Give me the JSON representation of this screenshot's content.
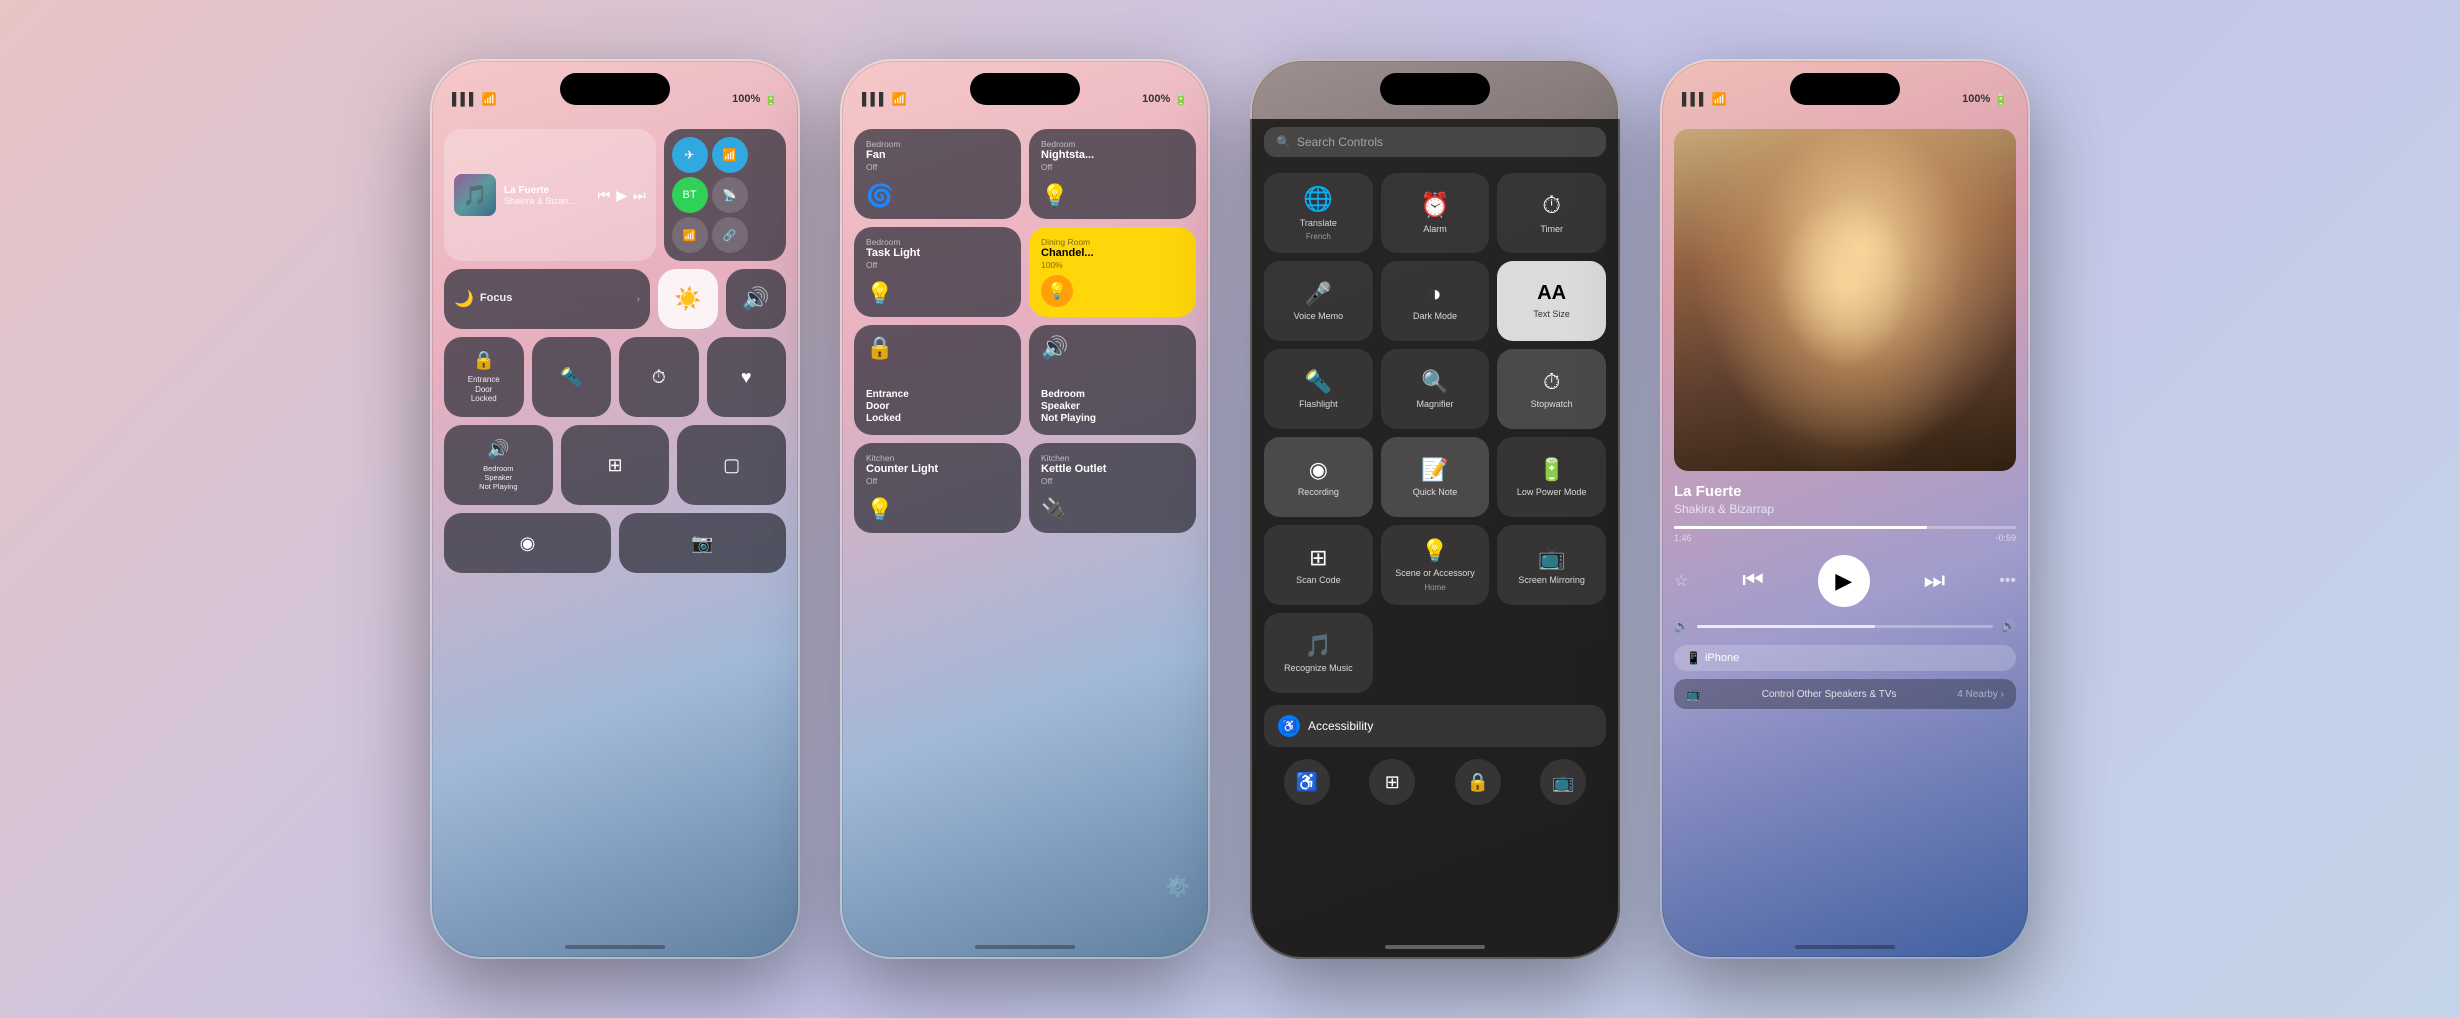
{
  "phones": [
    {
      "id": "phone1",
      "type": "control-center",
      "status": {
        "signal": "▌▌▌",
        "wifi": "WiFi",
        "battery": "100%"
      },
      "music": {
        "title": "La Fuerte",
        "artist": "Shakira & Bizarr..."
      },
      "connectivity": {
        "airplane": "✈",
        "wifi": "WiFi",
        "bluetooth": "BT",
        "cellular": "Cell",
        "airdrop": "AirDrop",
        "hotspot": "Hotspot"
      },
      "tiles": [
        {
          "icon": "🔒",
          "label": "Entrance\nDoor\nLocked",
          "type": "dark"
        },
        {
          "icon": "🔦",
          "label": "Flashlight",
          "type": "dark"
        },
        {
          "icon": "⏱",
          "label": "Timer",
          "type": "dark"
        },
        {
          "icon": "🔊",
          "label": "Bedroom\nSpeaker\nNot Playing",
          "type": "dark"
        },
        {
          "icon": "⊞",
          "label": "Calculator",
          "type": "dark"
        },
        {
          "icon": "▢",
          "label": "Screen Mirroring",
          "type": "dark"
        },
        {
          "icon": "◉",
          "label": "Recording",
          "type": "dark"
        },
        {
          "icon": "📷",
          "label": "Camera",
          "type": "dark"
        }
      ],
      "focus": "Focus",
      "brightness": "Brightness",
      "volume": "Volume"
    },
    {
      "id": "phone2",
      "type": "smart-home",
      "status": {
        "signal": "▌▌▌",
        "wifi": "WiFi",
        "battery": "100%"
      },
      "home_tiles": [
        {
          "room": "Bedroom",
          "name": "Fan",
          "status": "Off",
          "icon": "🌀"
        },
        {
          "room": "Bedroom",
          "name": "Nightsta...",
          "status": "Off",
          "icon": "💡"
        },
        {
          "room": "Bedroom",
          "name": "Task Light",
          "status": "Off",
          "icon": "💡"
        },
        {
          "room": "Dining Room",
          "name": "Chandel...",
          "status": "100%",
          "icon": "💡",
          "active": true
        },
        {
          "room": "",
          "name": "Entrance\nDoor\nLocked",
          "status": "",
          "icon": "🔒"
        },
        {
          "room": "",
          "name": "Bedroom\nSpeaker\nNot Playing",
          "status": "",
          "icon": "🔊"
        },
        {
          "room": "Kitchen",
          "name": "Counter Light",
          "status": "Off",
          "icon": "💡"
        },
        {
          "room": "Kitchen",
          "name": "Kettle Outlet",
          "status": "Off",
          "icon": "🔌"
        }
      ]
    },
    {
      "id": "phone3",
      "type": "add-controls",
      "search_placeholder": "Search Controls",
      "controls": [
        {
          "icon": "🌐",
          "name": "Translate",
          "sub": "French"
        },
        {
          "icon": "⏰",
          "name": "Alarm",
          "sub": ""
        },
        {
          "icon": "⏱",
          "name": "Timer",
          "sub": ""
        },
        {
          "icon": "🎤",
          "name": "Voice Memo",
          "sub": ""
        },
        {
          "icon": "◑",
          "name": "Dark Mode",
          "sub": ""
        },
        {
          "icon": "AA",
          "name": "Text Size",
          "sub": "",
          "special": "text-size"
        },
        {
          "icon": "🔦",
          "name": "Flashlight",
          "sub": ""
        },
        {
          "icon": "🔍",
          "name": "Magnifier",
          "sub": ""
        },
        {
          "icon": "⏱",
          "name": "Stopwatch",
          "sub": ""
        },
        {
          "icon": "◉",
          "name": "Recording",
          "sub": ""
        },
        {
          "icon": "📝",
          "name": "Quick Note",
          "sub": ""
        },
        {
          "icon": "🔋",
          "name": "Low Power\nMode",
          "sub": ""
        },
        {
          "icon": "⊞",
          "name": "Scan Code",
          "sub": ""
        },
        {
          "icon": "💡",
          "name": "Scene or\nAccessory",
          "sub": "Home"
        },
        {
          "icon": "📺",
          "name": "Screen\nMirroring",
          "sub": ""
        },
        {
          "icon": "🎵",
          "name": "Recognize\nMusic",
          "sub": ""
        },
        {
          "icon": "♿",
          "name": "Accessibility",
          "sub": ""
        }
      ],
      "accessibility_section": "Accessibility",
      "accessibility_icons": [
        "♿",
        "⊞",
        "🔒",
        "📺"
      ]
    },
    {
      "id": "phone4",
      "type": "now-playing",
      "status": {
        "signal": "▌▌▌",
        "wifi": "WiFi",
        "battery": "100%"
      },
      "song": {
        "title": "La Fuerte",
        "artist": "Shakira & Bizarrap",
        "elapsed": "1:46",
        "remaining": "-0:59",
        "progress": 74
      },
      "device": "iPhone",
      "speakers_label": "Control Other Speakers & TVs",
      "speakers_nearby": "4 Nearby ›"
    }
  ]
}
